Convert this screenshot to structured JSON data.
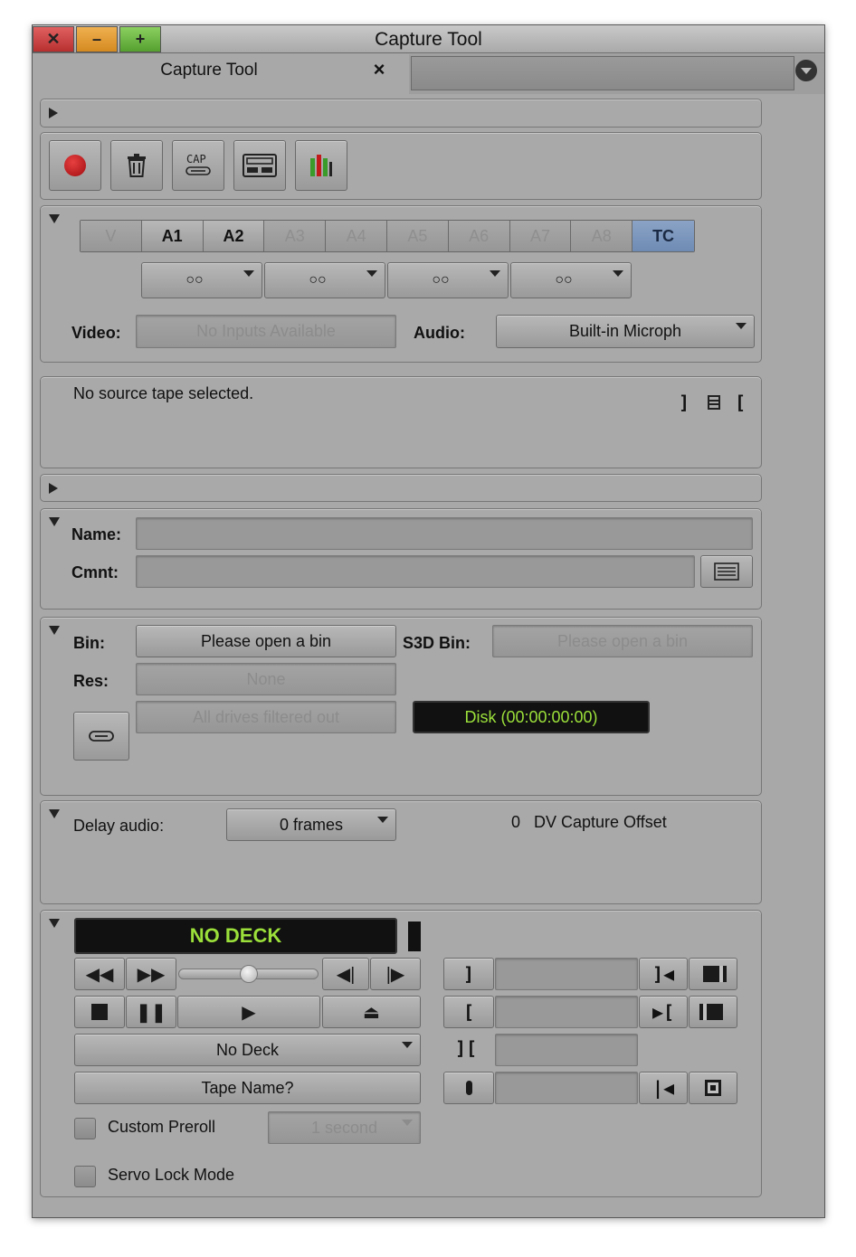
{
  "window": {
    "title": "Capture Tool",
    "buttons": {
      "close": "✕",
      "minimize": "–",
      "maximize": "+"
    }
  },
  "tab": {
    "label": "Capture Tool",
    "close": "×"
  },
  "tracks": {
    "labels": [
      "V",
      "A1",
      "A2",
      "A3",
      "A4",
      "A5",
      "A6",
      "A7",
      "A8",
      "TC"
    ],
    "channel_pair": "○○"
  },
  "inputs": {
    "video_label": "Video:",
    "video_value": "No Inputs Available",
    "audio_label": "Audio:",
    "audio_value": "Built-in Microph"
  },
  "source": {
    "status": "No source tape selected."
  },
  "clip": {
    "name_label": "Name:",
    "comment_label": "Cmnt:"
  },
  "target": {
    "bin_label": "Bin:",
    "bin_value": "Please open a bin",
    "s3d_label": "S3D Bin:",
    "s3d_value": "Please open a bin",
    "res_label": "Res:",
    "res_value": "None",
    "drives_value": "All drives filtered out",
    "disk_value": "Disk (00:00:00:00)"
  },
  "delay": {
    "label": "Delay audio:",
    "value": "0 frames",
    "offset_value": "0",
    "offset_label": "DV Capture Offset"
  },
  "deck": {
    "status": "NO DECK",
    "deck_select": "No Deck",
    "tape_name": "Tape Name?",
    "custom_preroll_label": "Custom Preroll",
    "preroll_value": "1 second",
    "servo_label": "Servo Lock Mode",
    "shuttle_position": 0.5
  },
  "colors": {
    "lcd_text": "#9be03a",
    "tc_track": "#7a95bd",
    "record": "#c0161a"
  }
}
